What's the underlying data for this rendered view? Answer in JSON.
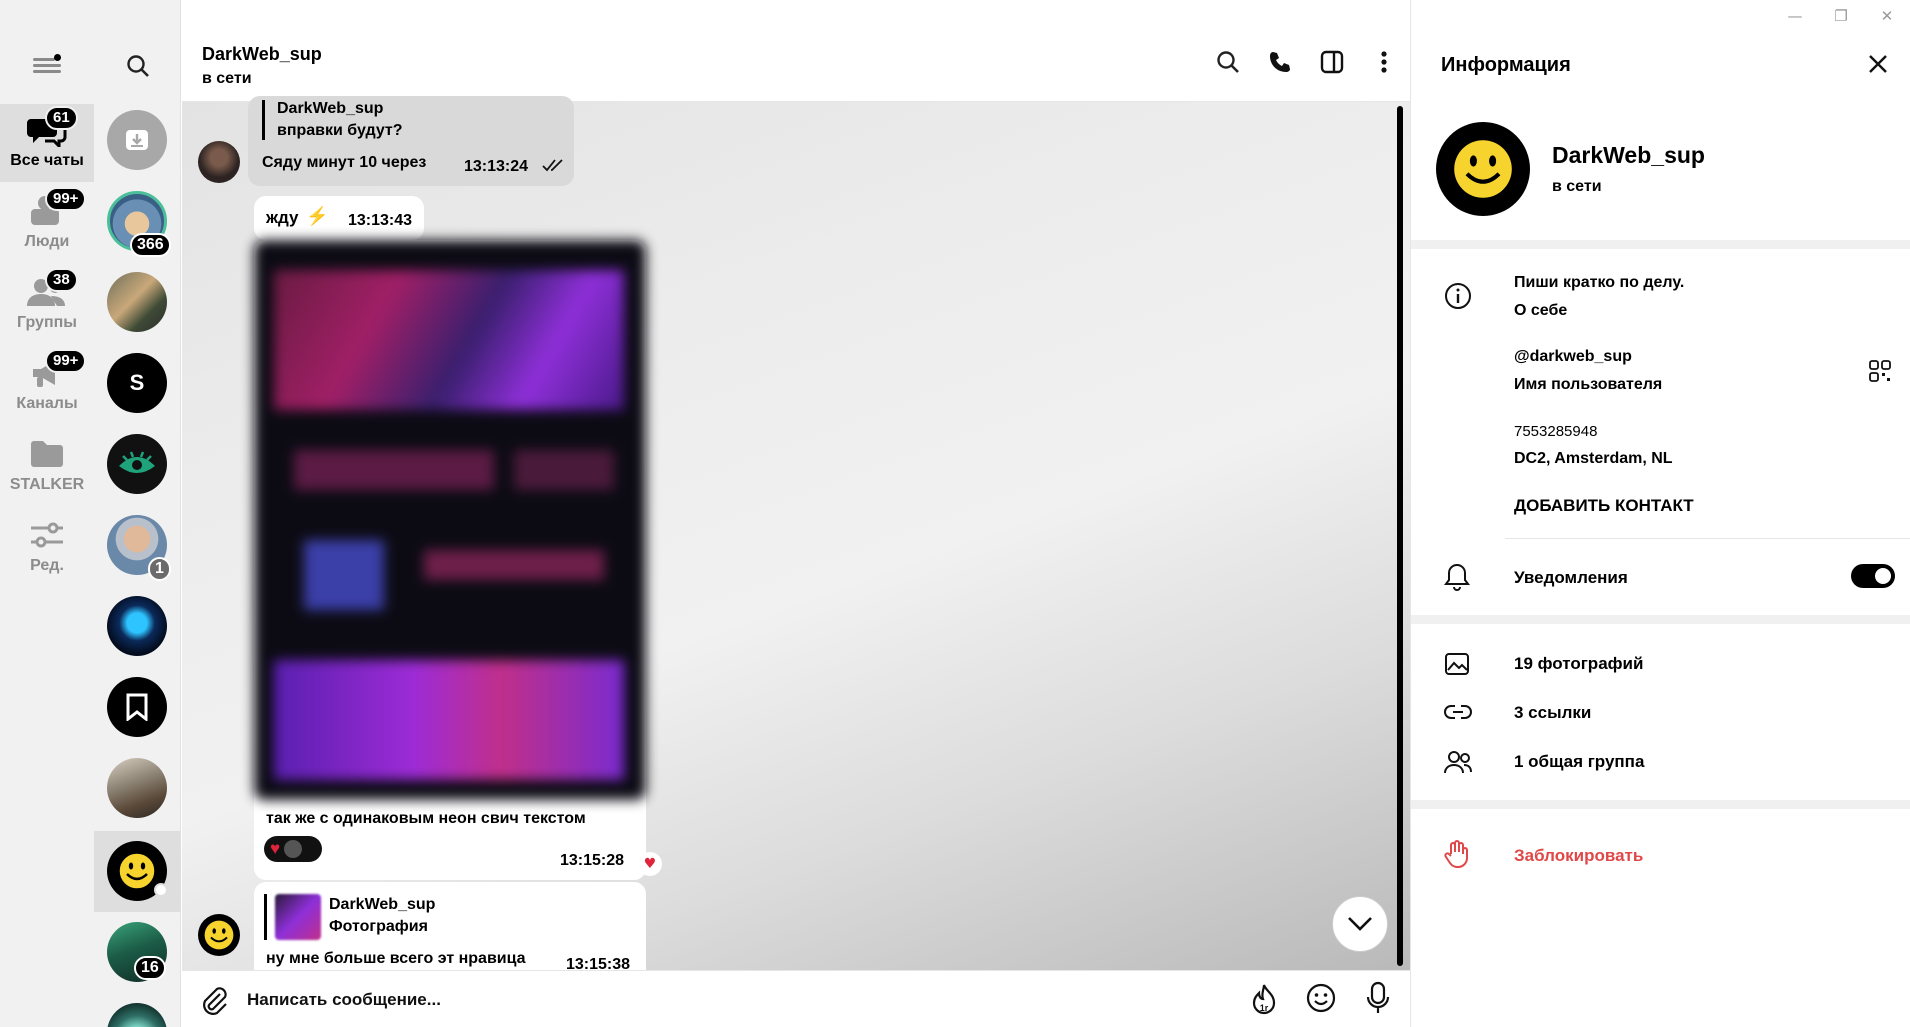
{
  "window": {
    "minimize": "—",
    "maximize": "❐",
    "close": "✕"
  },
  "folders": [
    {
      "label": "Все чаты",
      "badge": "61",
      "icon": "chat-bubbles-icon",
      "active": true
    },
    {
      "label": "Люди",
      "badge": "99+",
      "icon": "person-icon",
      "active": false
    },
    {
      "label": "Группы",
      "badge": "38",
      "icon": "people-icon",
      "active": false
    },
    {
      "label": "Каналы",
      "badge": "99+",
      "icon": "megaphone-icon",
      "active": false
    },
    {
      "label": "STALKER",
      "badge": "",
      "icon": "folder-icon",
      "active": false
    },
    {
      "label": "Ред.",
      "badge": "",
      "icon": "sliders-icon",
      "active": false
    }
  ],
  "chatlist": {
    "badges": {
      "hamster": "366",
      "person_old": "1",
      "car": "16"
    }
  },
  "chat": {
    "title": "DarkWeb_sup",
    "status": "в сети",
    "messages": {
      "m1_reply_name": "DarkWeb_sup",
      "m1_reply_text": "вправки будут?",
      "m1_text": "Сяду минут 10 через",
      "m1_time": "13:13:24",
      "m2_text": "жду",
      "m2_emoji": "⚡",
      "m2_time": "13:13:43",
      "m3_caption": "так же с одинаковым неон свич текстом",
      "m3_time": "13:15:28",
      "m4_reply_name": "DarkWeb_sup",
      "m4_reply_text": "Фотография",
      "m4_text": "ну мне больше всего эт нравица",
      "m4_time": "13:15:38"
    },
    "composer_placeholder": "Написать сообщение..."
  },
  "info": {
    "title": "Информация",
    "name": "DarkWeb_sup",
    "status": "в сети",
    "bio": "Пиши кратко по делу.",
    "bio_label": "О себе",
    "username": "@darkweb_sup",
    "username_label": "Имя пользователя",
    "user_id": "7553285948",
    "dc": "DC2, Amsterdam, NL",
    "add_contact": "ДОБАВИТЬ КОНТАКТ",
    "notifications": "Уведомления",
    "notifications_on": true,
    "photos": "19 фотографий",
    "links": "3 ссылки",
    "groups": "1 общая группа",
    "block": "Заблокировать"
  },
  "colors": {
    "accent": "#000000",
    "danger": "#e04848",
    "panel": "#f1f1f1"
  }
}
